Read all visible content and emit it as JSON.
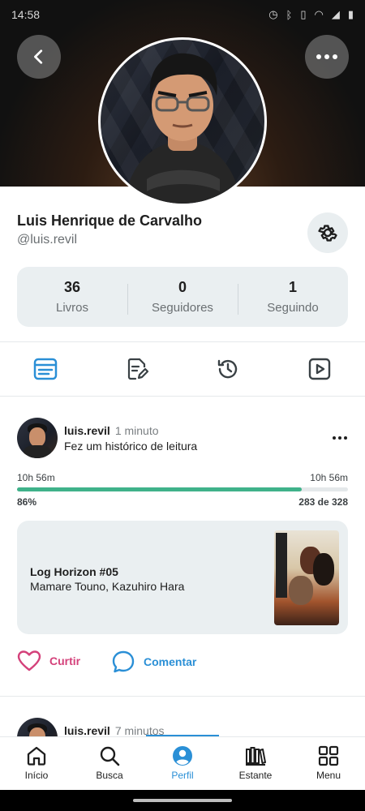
{
  "status_bar": {
    "time": "14:58"
  },
  "profile": {
    "name": "Luis Henrique de Carvalho",
    "handle": "@luis.revil"
  },
  "stats": [
    {
      "value": "36",
      "label": "Livros"
    },
    {
      "value": "0",
      "label": "Seguidores"
    },
    {
      "value": "1",
      "label": "Seguindo"
    }
  ],
  "tabs": [
    "list-icon",
    "edit-document-icon",
    "history-icon",
    "play-icon"
  ],
  "post": {
    "user": "luis.revil",
    "time": "1 minuto",
    "action": "Fez um histórico de leitura",
    "time_start": "10h 56m",
    "time_end": "10h 56m",
    "percent_text": "86%",
    "progress": 0.86,
    "pages": "283 de 328",
    "book_title": "Log Horizon #05",
    "book_author": "Mamare Touno, Kazuhiro Hara"
  },
  "actions": {
    "like": "Curtir",
    "comment": "Comentar"
  },
  "post2": {
    "user": "luis.revil",
    "time": "7 minutos"
  },
  "nav": [
    {
      "label": "Início",
      "icon": "home-icon"
    },
    {
      "label": "Busca",
      "icon": "search-icon"
    },
    {
      "label": "Perfil",
      "icon": "profile-icon"
    },
    {
      "label": "Estante",
      "icon": "bookshelf-icon"
    },
    {
      "label": "Menu",
      "icon": "grid-menu-icon"
    }
  ],
  "colors": {
    "accent": "#2a8fd6",
    "progress": "#3fb28a",
    "like": "#d4417a"
  }
}
